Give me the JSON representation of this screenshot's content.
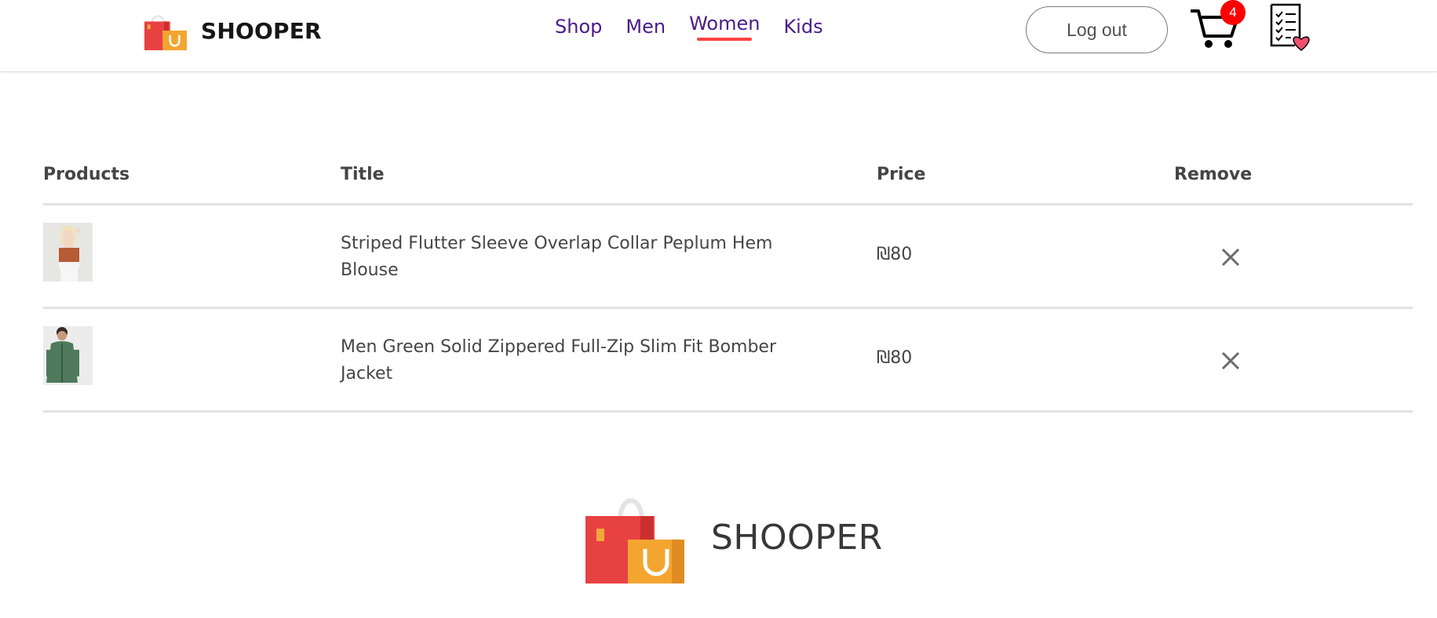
{
  "brand": {
    "name": "SHOOPER",
    "logo_icon": "shopping-bags-icon"
  },
  "nav": {
    "items": [
      {
        "label": "Shop"
      },
      {
        "label": "Men"
      },
      {
        "label": "Women",
        "active": true
      },
      {
        "label": "Kids"
      }
    ],
    "active_underline_color": "#ff4141",
    "link_color": "#4b1a8a"
  },
  "header_actions": {
    "logout_label": "Log out",
    "cart_icon": "cart-icon",
    "cart_count": "4",
    "cart_badge_color": "#ff0000",
    "wishlist_icon": "wishlist-icon"
  },
  "cart": {
    "columns": {
      "products": "Products",
      "title": "Title",
      "price": "Price",
      "remove": "Remove"
    },
    "items": [
      {
        "title": "Striped Flutter Sleeve Overlap Collar Peplum Hem Blouse",
        "price": "₪80",
        "image": "blouse-product-image",
        "remove_icon": "close-icon"
      },
      {
        "title": "Men Green Solid Zippered Full-Zip Slim Fit Bomber Jacket",
        "price": "₪80",
        "image": "jacket-product-image",
        "remove_icon": "close-icon"
      }
    ]
  },
  "footer": {
    "name": "SHOOPER",
    "logo_icon": "shopping-bags-icon"
  }
}
